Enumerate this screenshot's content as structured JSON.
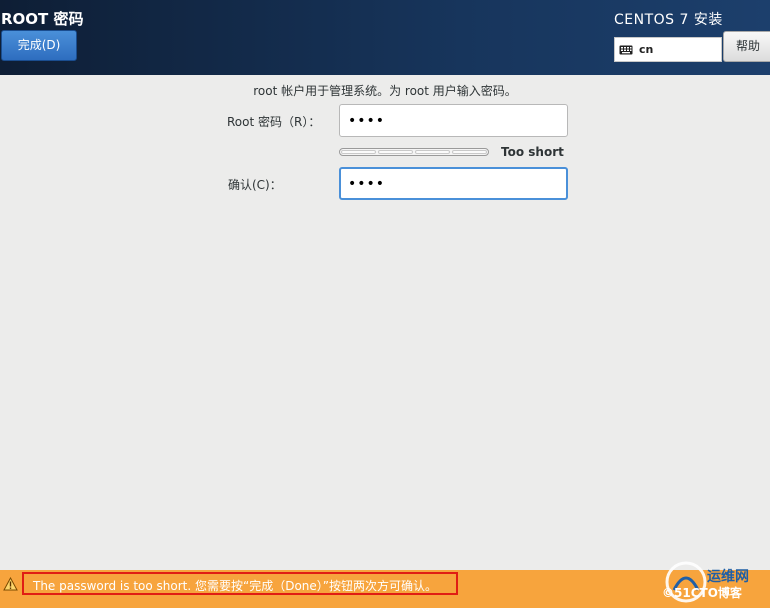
{
  "header": {
    "page_title": "ROOT 密码",
    "done_label": "完成(D)",
    "product_title": "CENTOS 7 安装",
    "keyboard_layout": "cn",
    "help_label": "帮助"
  },
  "form": {
    "description": "root 帐户用于管理系统。为 root 用户输入密码。",
    "root_password_label": "Root 密码（R）：",
    "root_password_value": "••••",
    "confirm_label": "确认(C)：",
    "confirm_value": "••••",
    "strength_text": "Too short",
    "strength_level": 0
  },
  "status_bar": {
    "warning_text": "The password is too short. 您需要按“完成（Done）”按钮两次方可确认。",
    "watermark_top": "运维网",
    "watermark_bottom": "©51CTO博客"
  },
  "colors": {
    "header_bg": "#17355c",
    "accent": "#4a90d9",
    "warning_bg": "#f7a43d",
    "highlight_box": "#e01d14"
  }
}
